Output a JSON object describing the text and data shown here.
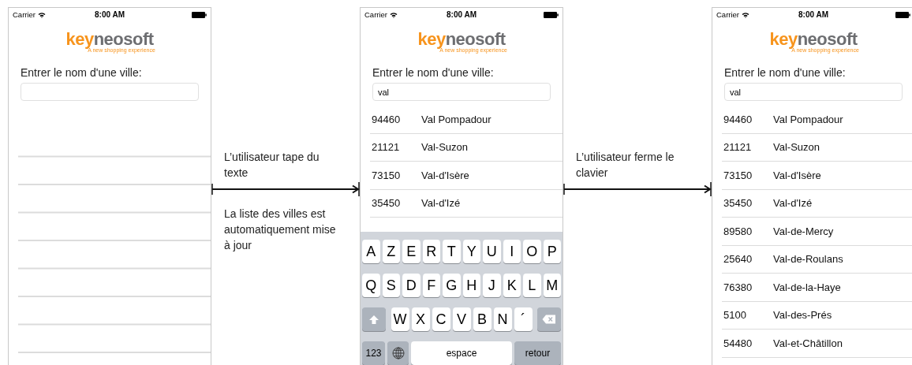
{
  "panels": [
    {
      "kind": "phone",
      "status": {
        "carrier": "Carrier",
        "time": "8:00 AM"
      },
      "logo": {
        "brand_first": "key",
        "brand_second": "neosoft",
        "tagline": "A new shopping experience"
      },
      "prompt": "Entrer le nom d'une ville:"
    },
    {
      "kind": "step",
      "caption_above": "L’utilisateur tape du texte",
      "caption_below": "La liste des villes est automatiquement mise à jour"
    },
    {
      "kind": "phone",
      "status": {
        "carrier": "Carrier",
        "time": "8:00 AM"
      },
      "logo": {
        "brand_first": "key",
        "brand_second": "neosoft",
        "tagline": "A new shopping experience"
      },
      "prompt": "Entrer le nom d'une ville:",
      "search": {
        "value": "val"
      },
      "cities": [
        {
          "code": "94460",
          "name": "Val Pompadour"
        },
        {
          "code": "21121",
          "name": "Val-Suzon"
        },
        {
          "code": "73150",
          "name": "Val-d'Isère"
        },
        {
          "code": "35450",
          "name": "Val-d'Izé"
        }
      ],
      "keyboard": {
        "rows": [
          {
            "keys": [
              {
                "kind": "letter",
                "label": "A"
              },
              {
                "kind": "letter",
                "label": "Z"
              },
              {
                "kind": "letter",
                "label": "E"
              },
              {
                "kind": "letter",
                "label": "R"
              },
              {
                "kind": "letter",
                "label": "T"
              },
              {
                "kind": "letter",
                "label": "Y"
              },
              {
                "kind": "letter",
                "label": "U"
              },
              {
                "kind": "letter",
                "label": "I"
              },
              {
                "kind": "letter",
                "label": "O"
              },
              {
                "kind": "letter",
                "label": "P"
              }
            ]
          },
          {
            "keys": [
              {
                "kind": "letter",
                "label": "Q"
              },
              {
                "kind": "letter",
                "label": "S"
              },
              {
                "kind": "letter",
                "label": "D"
              },
              {
                "kind": "letter",
                "label": "F"
              },
              {
                "kind": "letter",
                "label": "G"
              },
              {
                "kind": "letter",
                "label": "H"
              },
              {
                "kind": "letter",
                "label": "J"
              },
              {
                "kind": "letter",
                "label": "K"
              },
              {
                "kind": "letter",
                "label": "L"
              },
              {
                "kind": "letter",
                "label": "M"
              }
            ]
          },
          {
            "keys": [
              {
                "kind": "shift"
              },
              {
                "kind": "letter",
                "label": "W"
              },
              {
                "kind": "letter",
                "label": "X"
              },
              {
                "kind": "letter",
                "label": "C"
              },
              {
                "kind": "letter",
                "label": "V"
              },
              {
                "kind": "letter",
                "label": "B"
              },
              {
                "kind": "letter",
                "label": "N"
              },
              {
                "kind": "letter",
                "label": "´"
              },
              {
                "kind": "delete"
              }
            ]
          },
          {
            "keys": [
              {
                "kind": "mode",
                "label": "123"
              },
              {
                "kind": "globe"
              },
              {
                "kind": "space",
                "label": "espace"
              },
              {
                "kind": "return",
                "label": "retour"
              }
            ]
          }
        ]
      }
    },
    {
      "kind": "step",
      "caption_above": "L’utilisateur ferme le clavier"
    },
    {
      "kind": "phone",
      "status": {
        "carrier": "Carrier",
        "time": "8:00 AM"
      },
      "logo": {
        "brand_first": "key",
        "brand_second": "neosoft",
        "tagline": "A new shopping experience"
      },
      "prompt": "Entrer le nom d'une ville:",
      "search": {
        "value": "val"
      },
      "cities": [
        {
          "code": "94460",
          "name": "Val Pompadour"
        },
        {
          "code": "21121",
          "name": "Val-Suzon"
        },
        {
          "code": "73150",
          "name": "Val-d'Isère"
        },
        {
          "code": "35450",
          "name": "Val-d'Izé"
        },
        {
          "code": "89580",
          "name": "Val-de-Mercy"
        },
        {
          "code": "25640",
          "name": "Val-de-Roulans"
        },
        {
          "code": "76380",
          "name": "Val-de-la-Haye"
        },
        {
          "code": "5100",
          "name": "Val-des-Prés"
        },
        {
          "code": "54480",
          "name": "Val-et-Châtillon"
        }
      ]
    }
  ]
}
